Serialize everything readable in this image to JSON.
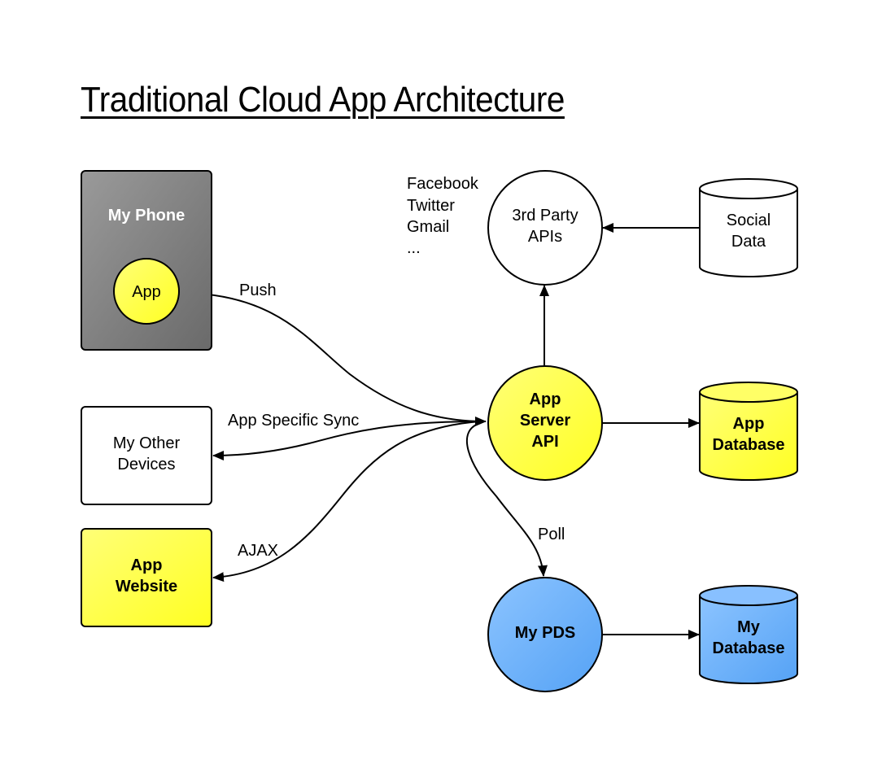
{
  "title": "Traditional Cloud App Architecture",
  "nodes": {
    "my_phone": {
      "label": "My Phone",
      "color": "#6e6e6e"
    },
    "app": {
      "label": "App",
      "color": "#ffff44"
    },
    "my_other_devices": {
      "label_lines": [
        "My Other",
        "Devices"
      ],
      "color": "#ffffff"
    },
    "app_website": {
      "label_lines": [
        "App",
        "Website"
      ],
      "color": "#ffff44"
    },
    "third_party_apis": {
      "label_lines": [
        "3rd Party",
        "APIs"
      ],
      "color": "#ffffff"
    },
    "social_data": {
      "label_lines": [
        "Social",
        "Data"
      ],
      "color": "#ffffff"
    },
    "app_server_api": {
      "label_lines": [
        "App",
        "Server",
        "API"
      ],
      "color": "#ffff44"
    },
    "app_database": {
      "label_lines": [
        "App",
        "Database"
      ],
      "color": "#ffff44"
    },
    "my_pds": {
      "label": "My PDS",
      "color": "#66aaff"
    },
    "my_database": {
      "label_lines": [
        "My",
        "Database"
      ],
      "color": "#66aaff"
    }
  },
  "third_party_examples": [
    "Facebook",
    "Twitter",
    "Gmail",
    "..."
  ],
  "edges": {
    "push": "Push",
    "app_specific_sync": "App Specific Sync",
    "ajax": "AJAX",
    "poll": "Poll"
  }
}
